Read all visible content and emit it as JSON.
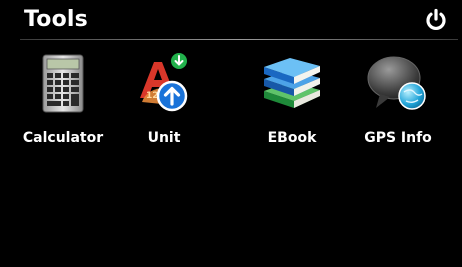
{
  "header": {
    "title": "Tools",
    "power_icon": "power-icon"
  },
  "tools": [
    {
      "label": "Calculator",
      "icon": "calculator-icon"
    },
    {
      "label": "Unit",
      "icon": "unit-converter-icon"
    },
    {
      "label": "EBook",
      "icon": "books-icon"
    },
    {
      "label": "GPS Info",
      "icon": "gps-info-icon"
    }
  ],
  "colors": {
    "background": "#000000",
    "text": "#ffffff",
    "accent_blue": "#1a73d9",
    "accent_green": "#22b14c",
    "accent_red": "#d9372a"
  }
}
